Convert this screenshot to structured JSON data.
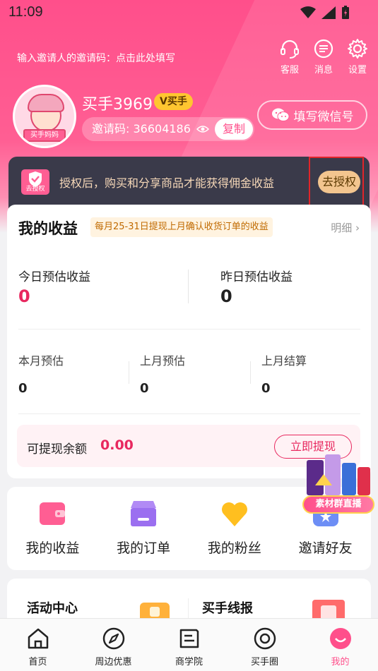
{
  "status_bar": {
    "time": "11:09"
  },
  "header": {
    "invite_prompt": "输入邀请人的邀请码：点击此处填写",
    "service_label": "客服",
    "message_label": "消息",
    "settings_label": "设置"
  },
  "profile": {
    "avatar_tag": "买手妈妈",
    "username": "买手3969",
    "badge": "V买手",
    "invite_code": "邀请码: 36604186",
    "copy_label": "复制",
    "wechat_label": "填写微信号"
  },
  "auth": {
    "icon_label": "去授权",
    "text": "授权后，购买和分享商品才能获得佣金收益",
    "button": "去授权"
  },
  "earnings": {
    "title": "我的收益",
    "note": "每月25-31日提现上月确认收货订单的收益",
    "detail": "明细",
    "today_label": "今日预估收益",
    "today_value": "0",
    "yesterday_label": "昨日预估收益",
    "yesterday_value": "0",
    "month_est_label": "本月预估",
    "month_est_value": "0",
    "last_month_est_label": "上月预估",
    "last_month_est_value": "0",
    "last_month_settle_label": "上月结算",
    "last_month_settle_value": "0",
    "withdraw_label": "可提现余额",
    "withdraw_value": "0.00",
    "withdraw_button": "立即提现"
  },
  "promo": {
    "label": "素材群直播"
  },
  "grid": [
    {
      "label": "我的收益",
      "icon": "wallet-icon"
    },
    {
      "label": "我的订单",
      "icon": "orders-icon"
    },
    {
      "label": "我的粉丝",
      "icon": "heart-icon"
    },
    {
      "label": "邀请好友",
      "icon": "invite-icon"
    }
  ],
  "activity": {
    "center": "活动中心",
    "news": "买手线报"
  },
  "tabs": [
    {
      "label": "首页",
      "icon": "home-icon"
    },
    {
      "label": "周边优惠",
      "icon": "compass-icon"
    },
    {
      "label": "商学院",
      "icon": "school-icon"
    },
    {
      "label": "买手圈",
      "icon": "circle-icon"
    },
    {
      "label": "我的",
      "icon": "profile-icon"
    }
  ],
  "colors": {
    "brand": "#ff4f8b",
    "accent_red": "#e8285f",
    "auth_bg": "#3a3a4a",
    "auth_btn": "#f3c58f",
    "badge": "#ffc630"
  }
}
